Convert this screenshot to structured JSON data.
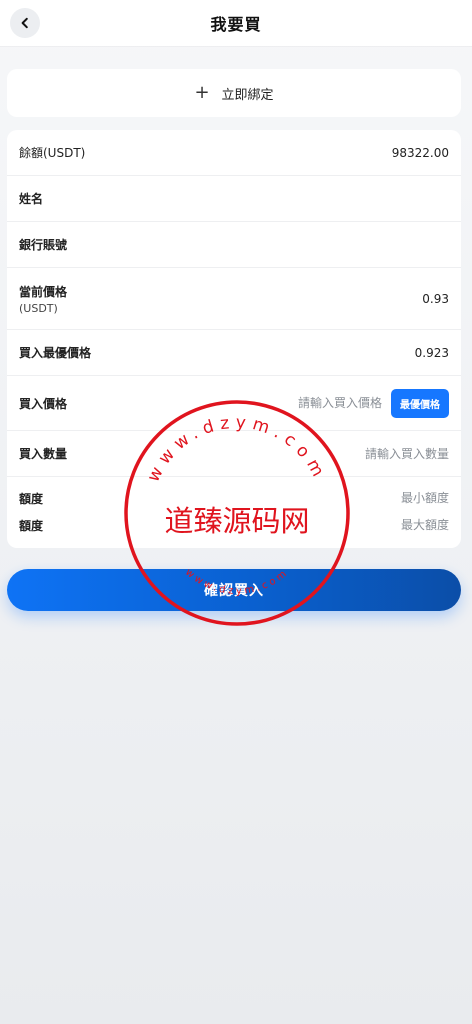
{
  "header": {
    "title": "我要買",
    "back_icon": "chevron-left-icon"
  },
  "bind": {
    "icon": "plus-icon",
    "label": "立即綁定"
  },
  "form": {
    "balance": {
      "label": "餘額(USDT)",
      "value": "98322.00"
    },
    "name": {
      "label": "姓名"
    },
    "bank_account": {
      "label": "銀行賬號"
    },
    "current_price": {
      "label": "當前價格",
      "label_sub": "(USDT)",
      "value": "0.93"
    },
    "best_buy_price": {
      "label": "買入最優價格",
      "value": "0.923"
    },
    "buy_price": {
      "label": "買入價格",
      "placeholder": "請輸入買入價格",
      "best_button": "最優價格"
    },
    "buy_quantity": {
      "label": "買入數量",
      "placeholder": "請輸入買入數量"
    },
    "limit_min": {
      "label": "額度",
      "placeholder": "最小額度"
    },
    "limit_max": {
      "label": "額度",
      "placeholder": "最大額度"
    }
  },
  "confirm_button": "確認買入",
  "watermark": {
    "center": "道臻源码网",
    "ring_text": "www.dzym.com"
  },
  "colors": {
    "accent": "#1677ff",
    "watermark": "#e0141e"
  }
}
